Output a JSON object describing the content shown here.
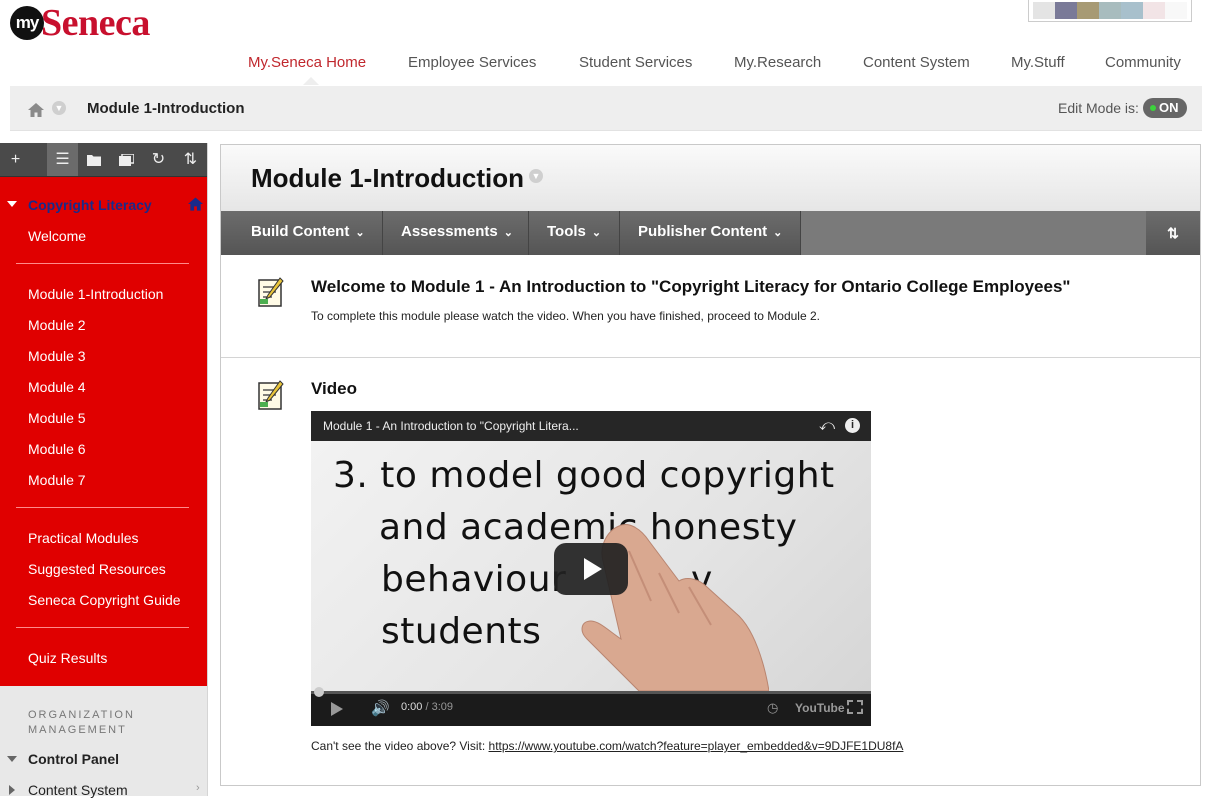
{
  "brand": {
    "logo_prefix": "my",
    "logo_name": "Seneca"
  },
  "swatch_colors": [
    "#e4e4e4",
    "#7a7a98",
    "#a79a74",
    "#a8bcbe",
    "#a8c0cc",
    "#f2e4e6",
    "#f8f8f8"
  ],
  "topnav": {
    "items": [
      {
        "label": "My.Seneca Home",
        "active": true
      },
      {
        "label": "Employee Services"
      },
      {
        "label": "Student Services"
      },
      {
        "label": "My.Research"
      },
      {
        "label": "Content System"
      },
      {
        "label": "My.Stuff"
      },
      {
        "label": "Community"
      }
    ]
  },
  "breadcrumb": {
    "current": "Module 1-Introduction"
  },
  "edit_mode": {
    "label": "Edit Mode is:",
    "state": "ON"
  },
  "left_toolbar": {
    "icons": [
      "plus-icon",
      "list-icon",
      "folder-icon",
      "window-icon",
      "refresh-icon",
      "sort-icon"
    ]
  },
  "course_menu": {
    "course_title": "Copyright Literacy",
    "items": [
      "Welcome",
      "Module 1-Introduction",
      "Module 2",
      "Module 3",
      "Module 4",
      "Module 5",
      "Module 6",
      "Module 7",
      "Practical Modules",
      "Suggested Resources",
      "Seneca Copyright Guide",
      "Quiz Results"
    ]
  },
  "org": {
    "label": "ORGANIZATION MANAGEMENT",
    "control_panel": "Control Panel",
    "content_system": "Content System"
  },
  "content": {
    "title": "Module 1-Introduction",
    "actions": {
      "build": "Build Content",
      "assessments": "Assessments",
      "tools": "Tools",
      "publisher": "Publisher Content"
    },
    "item1": {
      "title": "Welcome to Module 1 - An Introduction to \"Copyright Literacy for Ontario College Employees\"",
      "description": "To complete this module please watch the video. When you have finished, proceed to Module 2."
    },
    "item2": {
      "title": "Video"
    },
    "video": {
      "title": "Module 1 - An Introduction to \"Copyright Litera...",
      "frame_lines": [
        "3. to model good copyright",
        "and academic honesty",
        "behaviour",
        "v",
        "students"
      ],
      "current_time": "0:00",
      "duration": "/ 3:09",
      "yt_label": "YouTube",
      "progress": 0
    },
    "cant_see": {
      "text": "Can't see the video above? Visit:",
      "link": "https://www.youtube.com/watch?feature=player_embedded&v=9DJFE1DU8fA"
    }
  }
}
